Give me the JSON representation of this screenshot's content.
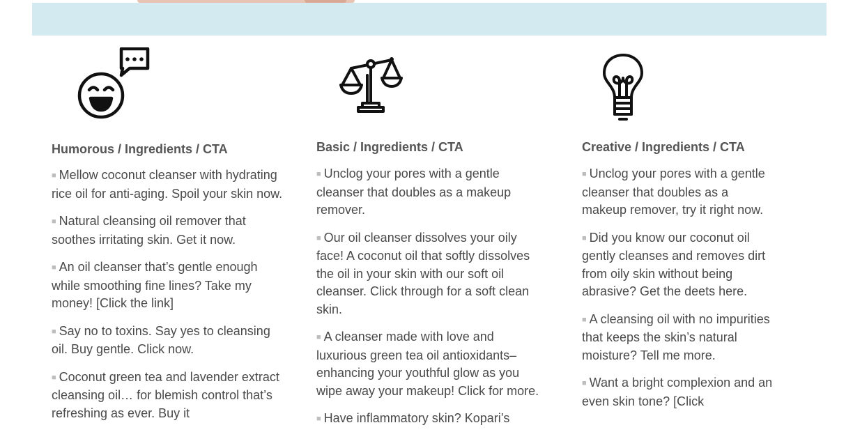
{
  "columns": [
    {
      "icon": "laughing-face-speech-bubble-icon",
      "title": "Humorous / Ingredients / CTA",
      "items": [
        "Mellow coconut cleanser with hydrating rice oil for anti-aging. Spoil your skin now.",
        "Natural cleansing oil remover that soothes irritating skin. Get it now.",
        "An oil cleanser that’s gentle enough while smoothing fine lines? Take my money! [Click the link]",
        "Say no to toxins. Say yes to cleansing oil. Buy gentle. Click now.",
        "Coconut green tea and lavender extract cleansing oil… for blemish control that’s refreshing as ever. Buy it"
      ]
    },
    {
      "icon": "balance-scale-icon",
      "title": "Basic / Ingredients / CTA",
      "items": [
        "Unclog your pores with a gentle cleanser that doubles as a makeup remover.",
        "Our oil cleanser dissolves your oily face! A coconut oil that softly dissolves the oil in your skin with our soft oil cleanser. Click through for a soft clean skin.",
        "A cleanser made with love and luxurious green tea oil antioxidants– enhancing your youthful glow as you wipe away your makeup! Click for more.",
        "Have inflammatory skin? Kopari’s"
      ]
    },
    {
      "icon": "lightbulb-icon",
      "title": "Creative / Ingredients / CTA",
      "items": [
        "Unclog your pores with a gentle cleanser that doubles as a makeup remover, try it right now.",
        "Did you know our coconut oil gently cleanses and removes dirt from oily skin without being abrasive? Get the deets here.",
        "A cleansing oil with no impurities that keeps the skin’s natural moisture? Tell me more.",
        "Want a bright complexion and an even skin tone? [Click"
      ]
    }
  ],
  "colors": {
    "banner": "#d3ebf0",
    "text": "#4a4a4a",
    "heading": "#555555",
    "bullet": "#bdbdbd"
  }
}
